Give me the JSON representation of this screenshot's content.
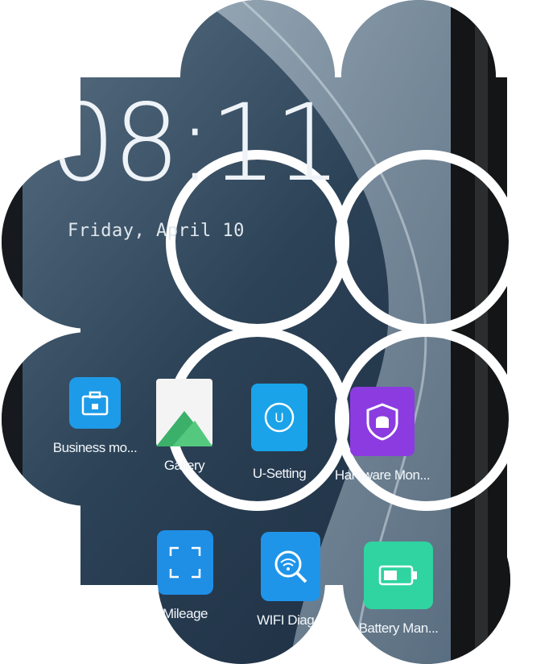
{
  "status": {
    "time": "08:11",
    "date": "Friday, April 10"
  },
  "apps": [
    {
      "label": "Business mo...",
      "icon": "briefcase-lock-icon",
      "color": "#1e9be8"
    },
    {
      "label": "Gallery",
      "icon": "gallery-icon",
      "color": "#f4f4f4"
    },
    {
      "label": "U-Setting",
      "icon": "u-setting-icon",
      "color": "#1aa3e8"
    },
    {
      "label": "Hardware Mon...",
      "icon": "shield-chip-icon",
      "color": "#8b3be0"
    },
    {
      "label": "Mileage",
      "icon": "scan-frame-icon",
      "color": "#1f8fe6"
    },
    {
      "label": "WIFI Diag...",
      "icon": "wifi-search-icon",
      "color": "#1f95ea"
    },
    {
      "label": "Battery Man...",
      "icon": "battery-icon",
      "color": "#2fd4a0"
    }
  ],
  "colors": {
    "wallpaper_dark": "#1b2a3d",
    "wallpaper_mid": "#3d5468",
    "device_frame": "#141516"
  }
}
